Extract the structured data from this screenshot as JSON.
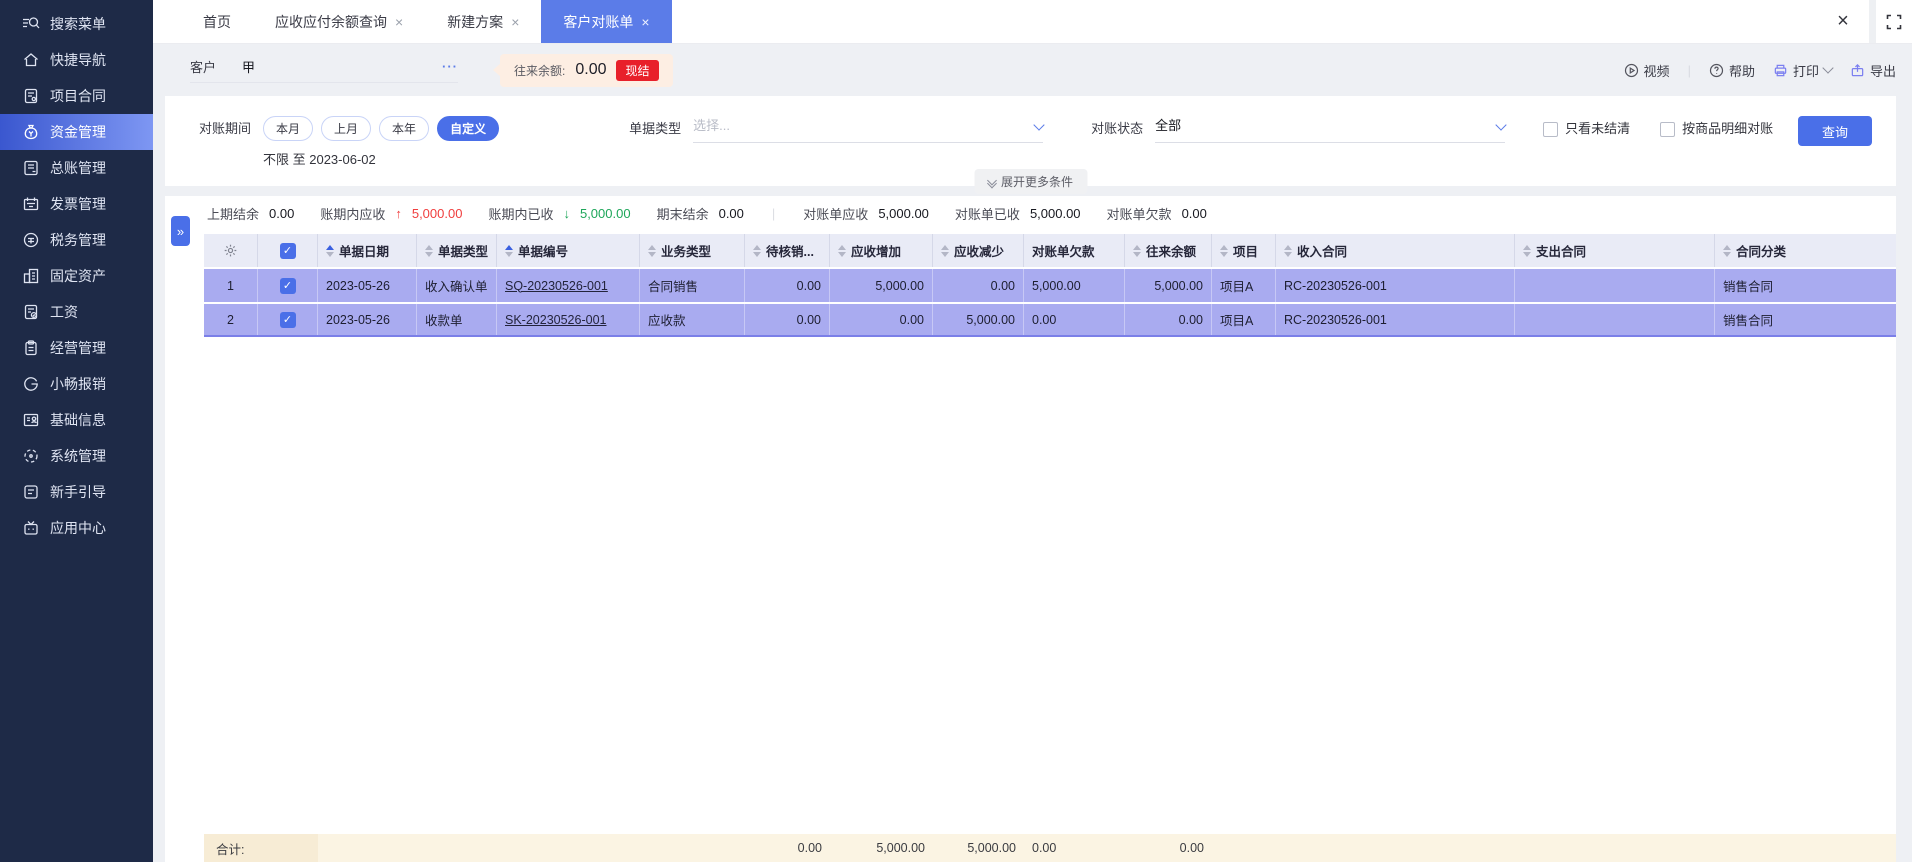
{
  "colors": {
    "accent": "#4a6fe8",
    "row_purple": "#a9abf0",
    "badge_red": "#e8202a",
    "trend_up_red": "#f03e3e",
    "trend_down_green": "#1ea65a",
    "footer_cream": "#fbf4e3",
    "sidebar_navy": "#1e2a47"
  },
  "sidebar": {
    "items": [
      {
        "label": "搜索菜单",
        "icon": "search-icon"
      },
      {
        "label": "快捷导航",
        "icon": "home-icon"
      },
      {
        "label": "项目合同",
        "icon": "contract-icon"
      },
      {
        "label": "资金管理",
        "icon": "funds-icon",
        "active": true
      },
      {
        "label": "总账管理",
        "icon": "ledger-icon"
      },
      {
        "label": "发票管理",
        "icon": "invoice-icon"
      },
      {
        "label": "税务管理",
        "icon": "tax-icon"
      },
      {
        "label": "固定资产",
        "icon": "fixed-assets-icon"
      },
      {
        "label": "工资",
        "icon": "payroll-icon"
      },
      {
        "label": "经营管理",
        "icon": "operations-icon"
      },
      {
        "label": "小畅报销",
        "icon": "reimburse-icon"
      },
      {
        "label": "基础信息",
        "icon": "base-info-icon"
      },
      {
        "label": "系统管理",
        "icon": "system-icon"
      },
      {
        "label": "新手引导",
        "icon": "guide-icon"
      },
      {
        "label": "应用中心",
        "icon": "app-center-icon"
      }
    ]
  },
  "tabs": {
    "items": [
      {
        "label": "首页",
        "closable": false
      },
      {
        "label": "应收应付余额查询",
        "closable": true
      },
      {
        "label": "新建方案",
        "closable": true
      },
      {
        "label": "客户对账单",
        "closable": true,
        "active": true
      }
    ],
    "close_glyph": "×"
  },
  "window": {
    "close": "×"
  },
  "toolbar": {
    "customer_label": "客户",
    "customer_value": "甲",
    "ellipsis": "···",
    "balance_label": "往来余额:",
    "balance_value": "0.00",
    "badge": "现结",
    "video": "视频",
    "help": "帮助",
    "print": "打印",
    "export": "导出"
  },
  "filters": {
    "period_label": "对账期间",
    "period_options": [
      "本月",
      "上月",
      "本年",
      "自定义"
    ],
    "period_active": "自定义",
    "period_range": "不限 至 2023-06-02",
    "doc_type_label": "单据类型",
    "doc_type_placeholder": "选择...",
    "status_label": "对账状态",
    "status_value": "全部",
    "checkbox_unsettled": "只看未结清",
    "checkbox_by_goods": "按商品明细对账",
    "query_button": "查询",
    "expand_more": "展开更多条件"
  },
  "summary": {
    "prev_balance_label": "上期结余",
    "prev_balance_value": "0.00",
    "period_receivable_label": "账期内应收",
    "period_receivable_value": "5,000.00",
    "period_receivable_trend": "↑",
    "period_received_label": "账期内已收",
    "period_received_value": "5,000.00",
    "period_received_trend": "↓",
    "end_balance_label": "期末结余",
    "end_balance_value": "0.00",
    "stmt_receivable_label": "对账单应收",
    "stmt_receivable_value": "5,000.00",
    "stmt_received_label": "对账单已收",
    "stmt_received_value": "5,000.00",
    "stmt_due_label": "对账单欠款",
    "stmt_due_value": "0.00"
  },
  "table": {
    "columns": [
      {
        "label": "单据日期",
        "sort": "asc"
      },
      {
        "label": "单据类型",
        "sort": "both"
      },
      {
        "label": "单据编号",
        "sort": "asc"
      },
      {
        "label": "业务类型",
        "sort": "both"
      },
      {
        "label": "待核销...",
        "sort": "both"
      },
      {
        "label": "应收增加",
        "sort": "both"
      },
      {
        "label": "应收减少",
        "sort": "both"
      },
      {
        "label": "对账单欠款",
        "sort": "none"
      },
      {
        "label": "往来余额",
        "sort": "both"
      },
      {
        "label": "项目",
        "sort": "both"
      },
      {
        "label": "收入合同",
        "sort": "both"
      },
      {
        "label": "支出合同",
        "sort": "both"
      },
      {
        "label": "合同分类",
        "sort": "both"
      }
    ],
    "rows": [
      {
        "index": "1",
        "checked": true,
        "date": "2023-05-26",
        "doc_type": "收入确认单",
        "doc_no": "SQ-20230526-001",
        "biz_type": "合同销售",
        "pending": "0.00",
        "receivable_inc": "5,000.00",
        "receivable_dec": "0.00",
        "stmt_due": "5,000.00",
        "balance": "5,000.00",
        "project": "项目A",
        "income_contract": "RC-20230526-001",
        "expense_contract": "",
        "contract_category": "销售合同"
      },
      {
        "index": "2",
        "checked": true,
        "date": "2023-05-26",
        "doc_type": "收款单",
        "doc_no": "SK-20230526-001",
        "biz_type": "应收款",
        "pending": "0.00",
        "receivable_inc": "0.00",
        "receivable_dec": "5,000.00",
        "stmt_due": "0.00",
        "balance": "0.00",
        "project": "项目A",
        "income_contract": "RC-20230526-001",
        "expense_contract": "",
        "contract_category": "销售合同"
      }
    ],
    "footer": {
      "label": "合计:",
      "pending": "0.00",
      "receivable_inc": "5,000.00",
      "receivable_dec": "5,000.00",
      "stmt_due": "0.00",
      "balance": "0.00"
    },
    "check_glyph": "✓"
  }
}
